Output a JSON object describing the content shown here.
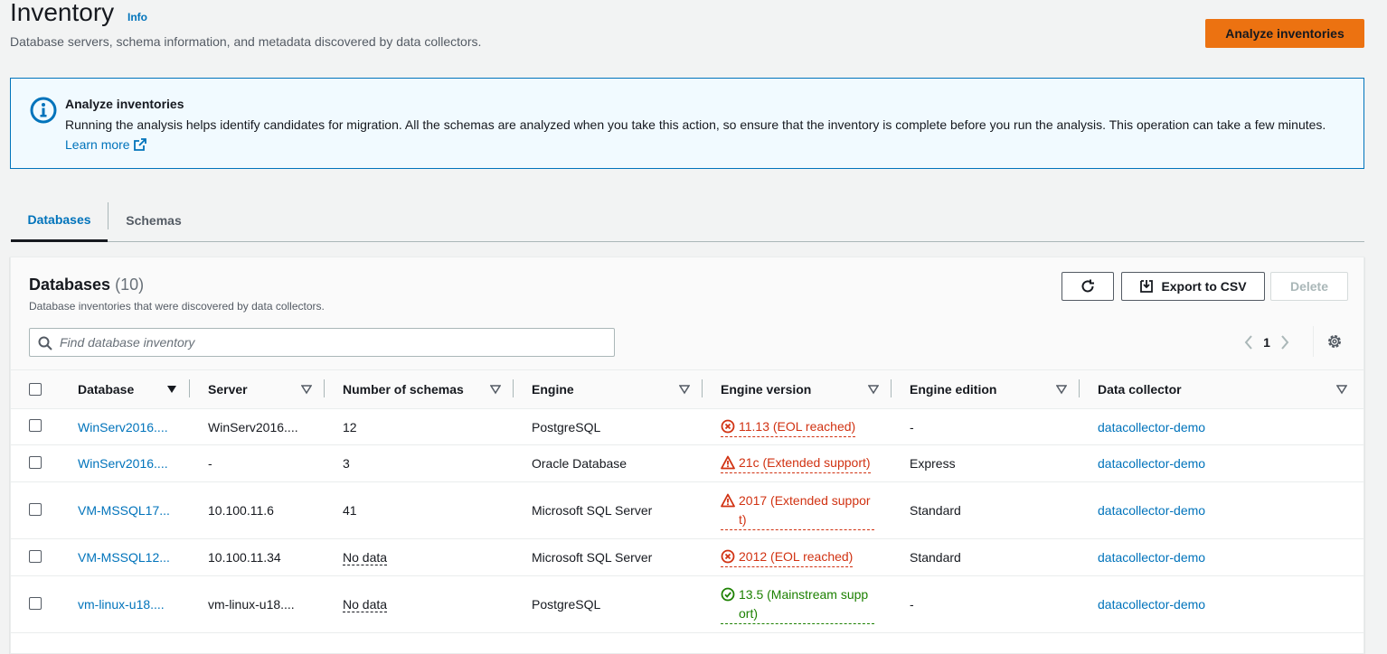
{
  "header": {
    "title": "Inventory",
    "info_label": "Info",
    "description": "Database servers, schema information, and metadata discovered by data collectors.",
    "primary_button": "Analyze inventories"
  },
  "alert": {
    "title": "Analyze inventories",
    "body": "Running the analysis helps identify candidates for migration. All the schemas are analyzed when you take this action, so ensure that the inventory is complete before you run the analysis. This operation can take a few minutes.",
    "link": "Learn more",
    "icon": "info-icon"
  },
  "tabs": [
    {
      "label": "Databases",
      "active": true
    },
    {
      "label": "Schemas",
      "active": false
    }
  ],
  "panel": {
    "title": "Databases",
    "count": "(10)",
    "description": "Database inventories that were discovered by data collectors.",
    "export_label": "Export to CSV",
    "delete_label": "Delete",
    "search_placeholder": "Find database inventory",
    "current_page": "1"
  },
  "table": {
    "columns": [
      "Database",
      "Server",
      "Number of schemas",
      "Engine",
      "Engine version",
      "Engine edition",
      "Data collector"
    ],
    "rows": [
      {
        "database": "WinServ2016....",
        "server": "WinServ2016....",
        "schemas": "12",
        "schemas_nodata": false,
        "engine": "PostgreSQL",
        "version": "11.13 (EOL reached)",
        "version_status": "error-circle",
        "edition": "-",
        "collector": "datacollector-demo"
      },
      {
        "database": "WinServ2016....",
        "server": "-",
        "schemas": "3",
        "schemas_nodata": false,
        "engine": "Oracle Database",
        "version": "21c (Extended support)",
        "version_status": "warning",
        "edition": "Express",
        "collector": "datacollector-demo"
      },
      {
        "database": "VM-MSSQL17...",
        "server": "10.100.11.6",
        "schemas": "41",
        "schemas_nodata": false,
        "engine": "Microsoft SQL Server",
        "version": "2017 (Extended suppor t)",
        "version_status": "warning",
        "edition": "Standard",
        "collector": "datacollector-demo"
      },
      {
        "database": "VM-MSSQL12...",
        "server": "10.100.11.34",
        "schemas": "No data",
        "schemas_nodata": true,
        "engine": "Microsoft SQL Server",
        "version": "2012 (EOL reached)",
        "version_status": "error-circle",
        "edition": "Standard",
        "collector": "datacollector-demo"
      },
      {
        "database": "vm-linux-u18....",
        "server": "vm-linux-u18....",
        "schemas": "No data",
        "schemas_nodata": true,
        "engine": "PostgreSQL",
        "version": "13.5 (Mainstream supp ort)",
        "version_status": "success",
        "edition": "-",
        "collector": "datacollector-demo"
      }
    ]
  },
  "colors": {
    "accent": "#0073bb",
    "primary_button": "#ec7211",
    "error": "#d13212",
    "success": "#1d8102"
  }
}
